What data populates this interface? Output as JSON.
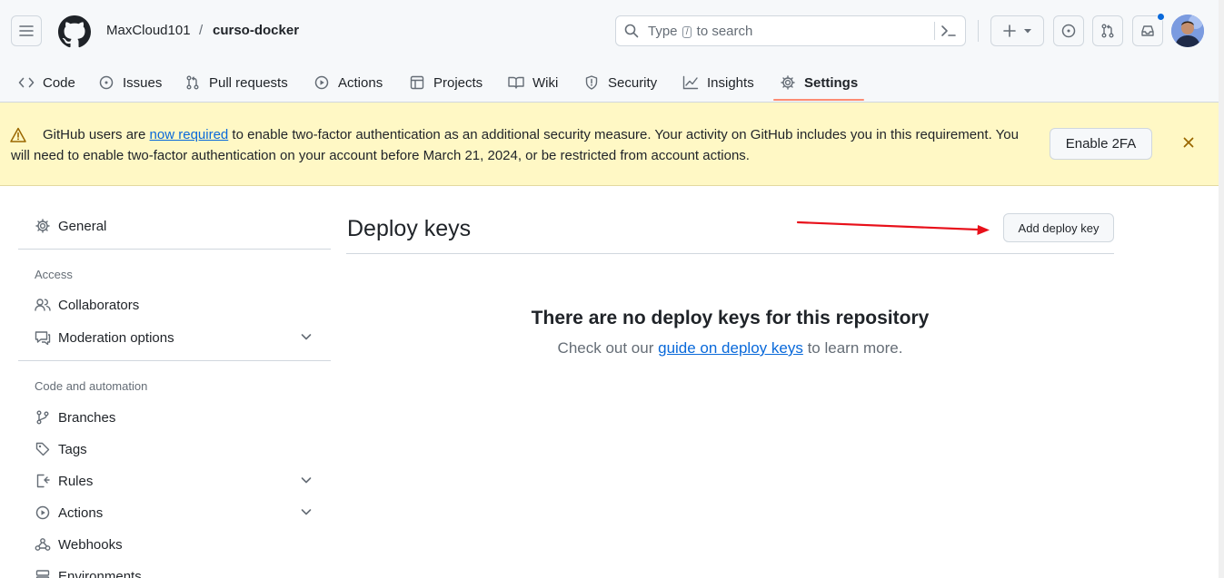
{
  "header": {
    "owner": "MaxCloud101",
    "separator": "/",
    "repo": "curso-docker",
    "search_prefix": "Type",
    "search_key": "/",
    "search_suffix": "to search"
  },
  "tabs": [
    {
      "label": "Code",
      "icon": "code-icon"
    },
    {
      "label": "Issues",
      "icon": "issue-opened-icon"
    },
    {
      "label": "Pull requests",
      "icon": "git-pull-request-icon"
    },
    {
      "label": "Actions",
      "icon": "play-icon"
    },
    {
      "label": "Projects",
      "icon": "table-icon"
    },
    {
      "label": "Wiki",
      "icon": "book-icon"
    },
    {
      "label": "Security",
      "icon": "shield-icon"
    },
    {
      "label": "Insights",
      "icon": "graph-icon"
    },
    {
      "label": "Settings",
      "icon": "gear-icon",
      "selected": true
    }
  ],
  "banner": {
    "text_before": "GitHub users are ",
    "link": "now required",
    "text_after": " to enable two-factor authentication as an additional security measure. Your activity on GitHub includes you in this requirement. You will need to enable two-factor authentication on your account before March 21, 2024, or be restricted from account actions.",
    "button": "Enable 2FA"
  },
  "sidebar": {
    "general": "General",
    "access_heading": "Access",
    "collaborators": "Collaborators",
    "moderation": "Moderation options",
    "code_heading": "Code and automation",
    "branches": "Branches",
    "tags": "Tags",
    "rules": "Rules",
    "actions": "Actions",
    "webhooks": "Webhooks",
    "environments": "Environments"
  },
  "main": {
    "title": "Deploy keys",
    "add_button": "Add deploy key",
    "empty_title": "There are no deploy keys for this repository",
    "empty_before": "Check out our ",
    "empty_link": "guide on deploy keys",
    "empty_after": " to learn more."
  },
  "colors": {
    "accent": "#0969da",
    "banner_bg": "#fff8c5",
    "tab_underline": "#fd8c73",
    "annotation_arrow": "#e8101a"
  }
}
